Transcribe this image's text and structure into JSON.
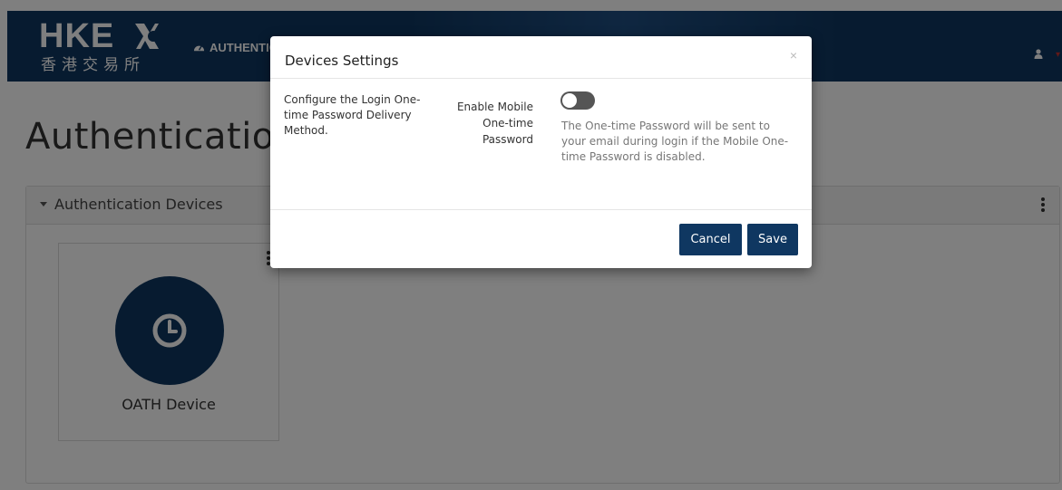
{
  "brand": {
    "logo_text": "HKEX",
    "logo_sub": "香港交易所"
  },
  "navbar": {
    "item_label": "AUTHENTICATION",
    "item_icon": "dashboard-icon",
    "user_icon": "user-icon"
  },
  "page": {
    "title": "Authentication"
  },
  "panel": {
    "title": "Authentication Devices",
    "devices": [
      {
        "label": "OATH Device",
        "icon": "clock-icon"
      }
    ]
  },
  "modal": {
    "title": "Devices Settings",
    "close": "×",
    "description": "Configure the Login One-time Password Delivery Method.",
    "field_label": "Enable Mobile One-time Password",
    "toggle_on": false,
    "help_text": "The One-time Password will be sent to your email during login if the Mobile One-time Password is disabled.",
    "cancel_label": "Cancel",
    "save_label": "Save"
  },
  "colors": {
    "navy": "#0f3761",
    "toggle_off": "#555555"
  }
}
